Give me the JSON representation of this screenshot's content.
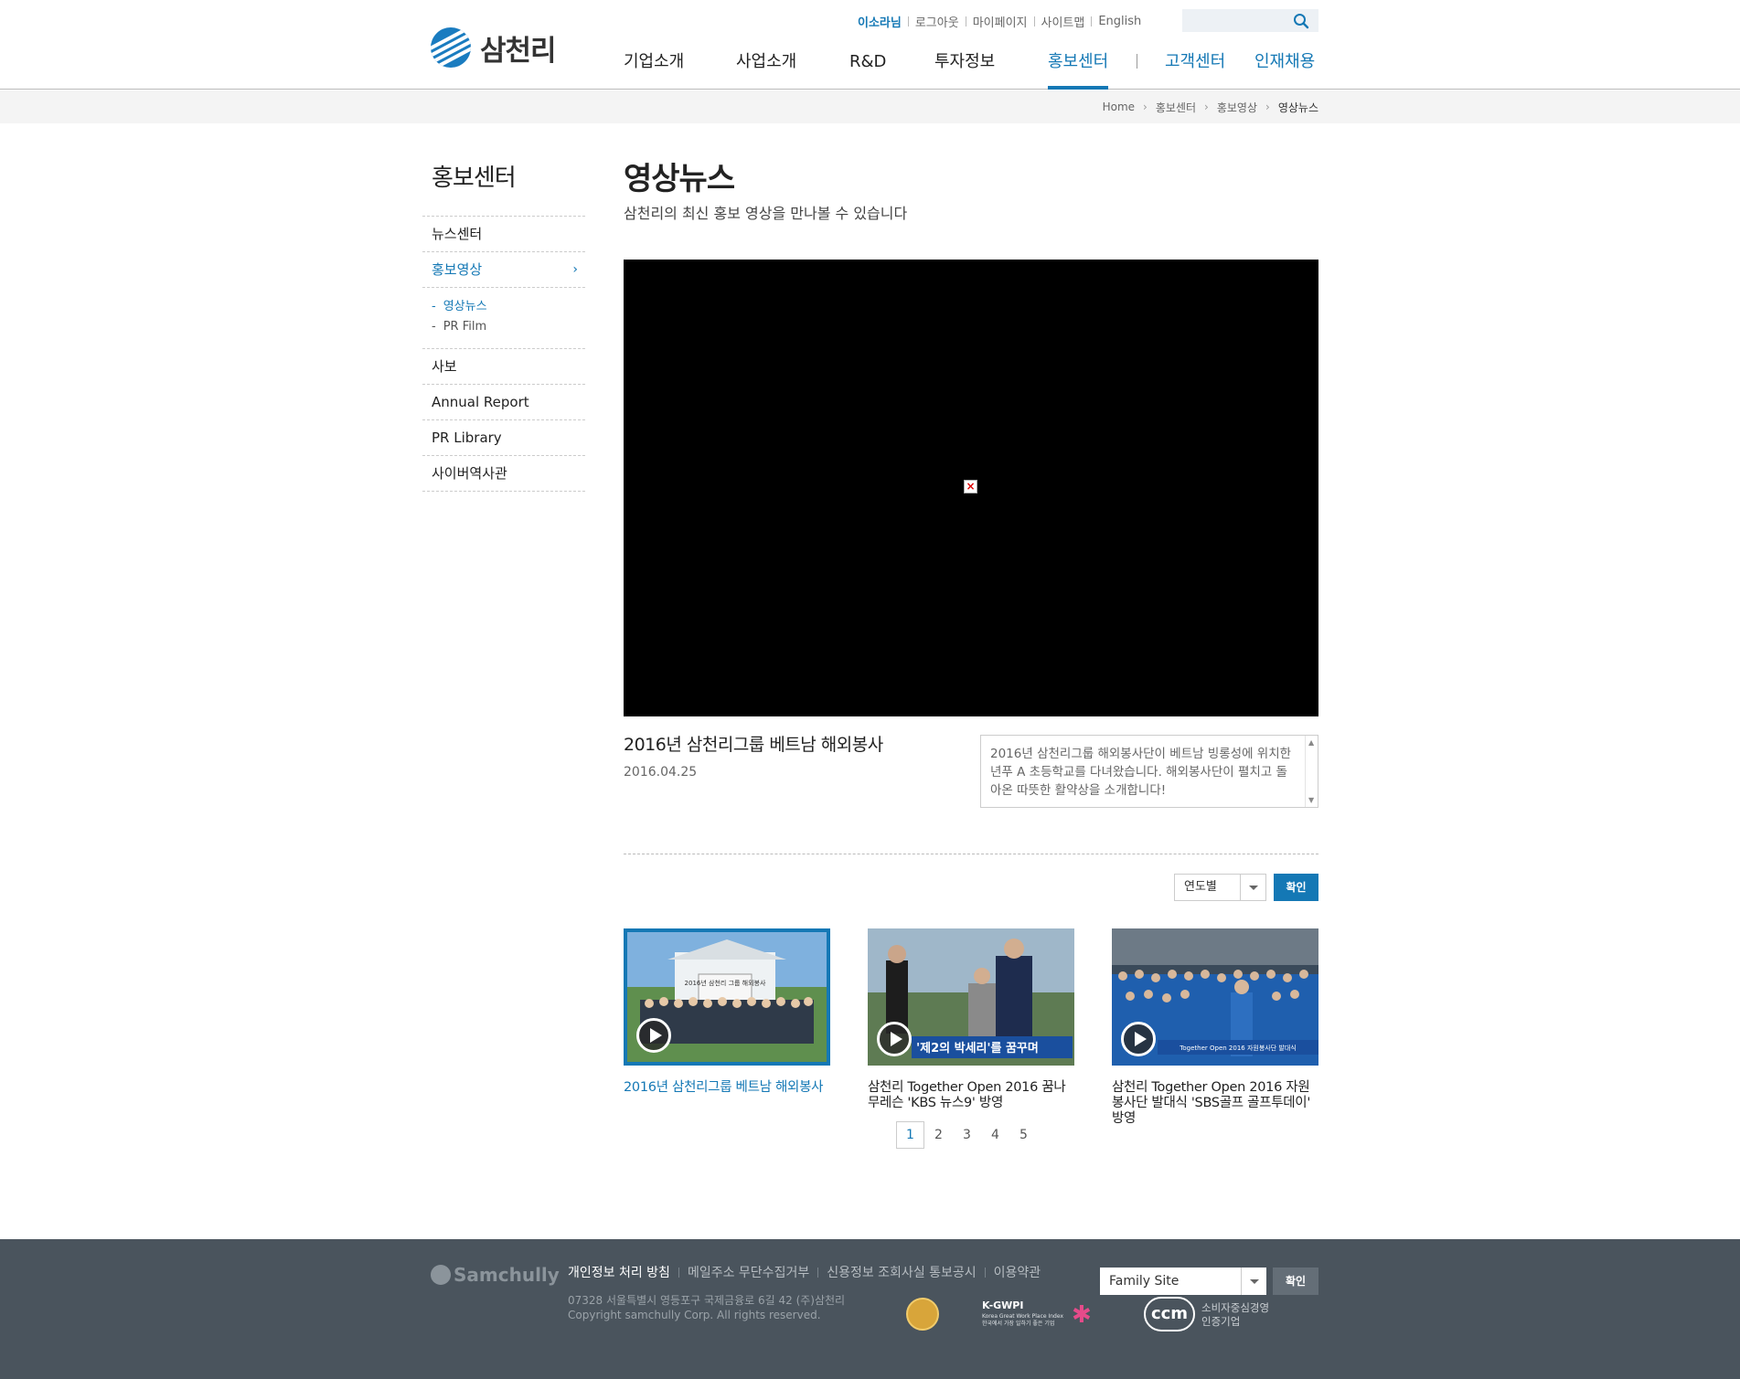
{
  "brand": {
    "logo_text": "삼천리",
    "accent_color": "#1478b5",
    "footer_bg": "#4a545d"
  },
  "utility_nav": [
    "이소라님",
    "로그아웃",
    "마이페이지",
    "사이트맵",
    "English"
  ],
  "search": {
    "placeholder": "",
    "icon": "search-icon"
  },
  "gnb": {
    "items": [
      "기업소개",
      "사업소개",
      "R&D",
      "투자정보",
      "홍보센터"
    ],
    "extra": [
      "고객센터",
      "인재채용"
    ],
    "active": "홍보센터"
  },
  "breadcrumb": [
    "Home",
    "홍보센터",
    "홍보영상",
    "영상뉴스"
  ],
  "lnb": {
    "title": "홍보센터",
    "items": [
      "뉴스센터",
      "홍보영상",
      "사보",
      "Annual Report",
      "PR Library",
      "사이버역사관"
    ],
    "sub_items": [
      "영상뉴스",
      "PR Film"
    ],
    "active_item": "홍보영상",
    "active_sub": "영상뉴스"
  },
  "page": {
    "title": "영상뉴스",
    "description": "삼천리의 최신 홍보 영상을 만나볼 수 있습니다"
  },
  "video": {
    "title": "2016년 삼천리그룹 베트남 해외봉사",
    "date": "2016.04.25",
    "description": "2016년 삼천리그룹 해외봉사단이 베트남 빙롱성에 위치한 년푸 A 초등학교를 다녀왔습니다. 해외봉사단이 펼치고 돌아온 따뜻한 활약상을 소개합니다!"
  },
  "filter": {
    "year_label": "연도별",
    "confirm_label": "확인"
  },
  "thumbnails": [
    {
      "title": "2016년 삼천리그룹 베트남 해외봉사",
      "active": true,
      "caption": "2016년 삼천리 그룹 해외봉사"
    },
    {
      "title": "삼천리 Together Open 2016 꿈나무레슨 'KBS 뉴스9' 방영",
      "active": false,
      "caption": "'제2의 박세리'를 꿈꾸며"
    },
    {
      "title": "삼천리 Together Open 2016 자원봉사단 발대식 'SBS골프 골프투데이' 방영",
      "active": false,
      "caption": "Together Open 2016 자원봉사단 발대식"
    }
  ],
  "pagination": {
    "pages": [
      "1",
      "2",
      "3",
      "4",
      "5"
    ],
    "current": "1"
  },
  "footer": {
    "logo_text": "Samchully",
    "links": [
      "개인정보 처리 방침",
      "메일주소 무단수집거부",
      "신용정보 조회사실 통보공시",
      "이용약관"
    ],
    "address": "07328 서울특별시 영등포구 국제금융로 6길 42 (주)삼천리",
    "copyright": "Copyright samchully Corp. All rights reserved.",
    "family_site_label": "Family Site",
    "family_confirm_label": "확인",
    "kgwpi_title": "K-GWPI",
    "kgwpi_sub": "Korea Great Work Place Index 한국에서 가장 일하기 좋은 기업",
    "ccm_mark": "ccm",
    "ccm_text_1": "소비자중심경영",
    "ccm_text_2": "인증기업"
  }
}
